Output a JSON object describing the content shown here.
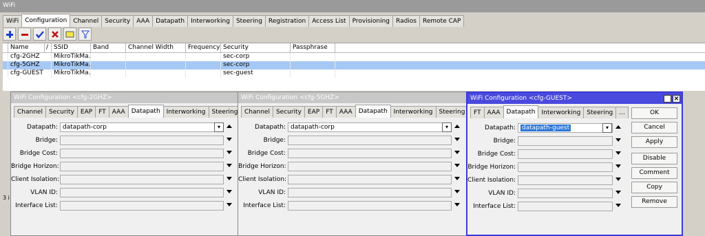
{
  "window": {
    "title": "WiFi"
  },
  "main_tabs": [
    "WiFi",
    "Configuration",
    "Channel",
    "Security",
    "AAA",
    "Datapath",
    "Interworking",
    "Steering",
    "Registration",
    "Access List",
    "Provisioning",
    "Radios",
    "Remote CAP"
  ],
  "table": {
    "columns": [
      "Name",
      "/",
      "SSID",
      "Band",
      "Channel Width",
      "Frequency",
      "Security",
      "Passphrase"
    ],
    "rows": [
      {
        "name": "cfg-2GHZ",
        "ssid": "MikroTikMa...",
        "security": "sec-corp"
      },
      {
        "name": "cfg-5GHZ",
        "ssid": "MikroTikMa...",
        "security": "sec-corp"
      },
      {
        "name": "cfg-GUEST",
        "ssid": "MikroTikMa...",
        "security": "sec-guest"
      }
    ],
    "status": "3 i"
  },
  "dialogs": [
    {
      "title": "WiFi Configuration <cfg-2GHZ>",
      "tabs": [
        "Channel",
        "Security",
        "EAP",
        "FT",
        "AAA",
        "Datapath",
        "Interworking",
        "Steering",
        "..."
      ],
      "active_tab": "Datapath",
      "datapath": "datapath-corp"
    },
    {
      "title": "WiFi Configuration <cfg-5GHZ>",
      "tabs": [
        "Channel",
        "Security",
        "EAP",
        "FT",
        "AAA",
        "Datapath",
        "Interworking",
        "Steering",
        "..."
      ],
      "active_tab": "Datapath",
      "datapath": "datapath-corp"
    },
    {
      "title": "WiFi Configuration <cfg-GUEST>",
      "tabs": [
        "FT",
        "AAA",
        "Datapath",
        "Interworking",
        "Steering",
        "..."
      ],
      "active_tab": "Datapath",
      "datapath": "datapath-guest"
    }
  ],
  "fields": [
    "Datapath:",
    "Bridge:",
    "Bridge Cost:",
    "Bridge Horizon:",
    "Client Isolation:",
    "VLAN ID:",
    "Interface List:"
  ],
  "buttons": [
    "OK",
    "Cancel",
    "Apply",
    "Disable",
    "Comment",
    "Copy",
    "Remove"
  ],
  "colors": {
    "selected_row": "#a6c8f5",
    "active_title": "#4a4ade",
    "inactive_title": "#c8c8c8"
  }
}
